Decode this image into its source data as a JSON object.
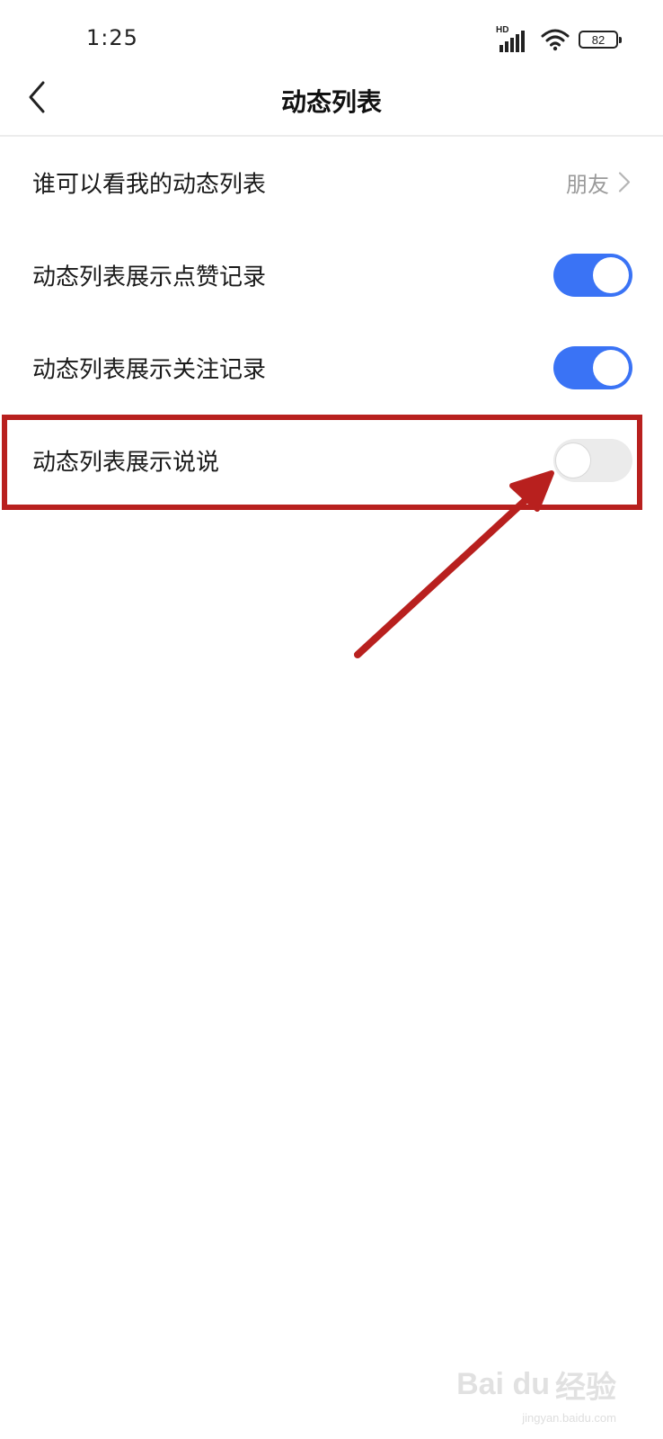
{
  "status_bar": {
    "time": "1:25",
    "network_label": "HD",
    "signal_icon": "signal-bars-icon",
    "wifi_icon": "wifi-icon",
    "battery_level": "82"
  },
  "nav": {
    "back_icon": "chevron-left-icon",
    "title": "动态列表"
  },
  "settings": {
    "items": [
      {
        "label": "谁可以看我的动态列表",
        "value": "朋友",
        "type": "link",
        "icon": "chevron-right-icon"
      },
      {
        "label": "动态列表展示点赞记录",
        "type": "toggle",
        "enabled": true
      },
      {
        "label": "动态列表展示关注记录",
        "type": "toggle",
        "enabled": true
      },
      {
        "label": "动态列表展示说说",
        "type": "toggle",
        "enabled": false
      }
    ]
  },
  "annotation": {
    "highlight_color": "#b8201e",
    "arrow_icon": "red-arrow-icon"
  },
  "colors": {
    "toggle_on": "#3a73f5",
    "toggle_off": "#ebebeb",
    "secondary_text": "#9a9a9a"
  },
  "watermark": {
    "logo": "Bai du",
    "text": "经验",
    "url": "jingyan.baidu.com"
  }
}
